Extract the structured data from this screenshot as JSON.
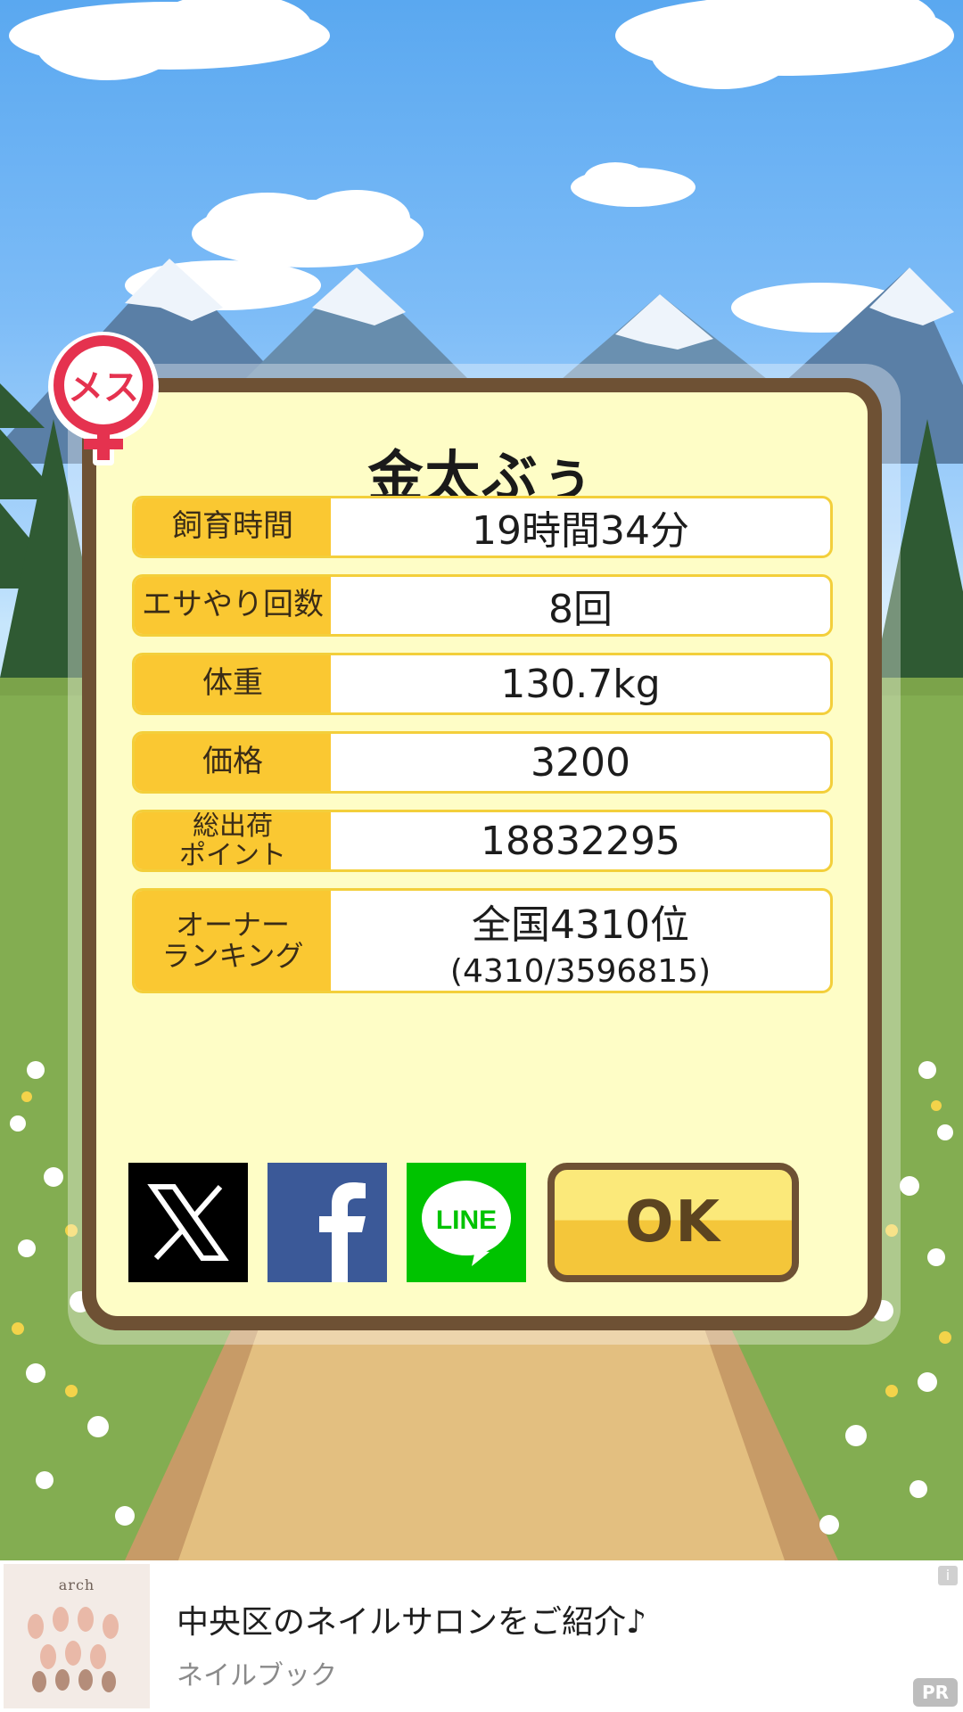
{
  "pet": {
    "name": "金太ぶぅ",
    "gender_badge": "メス"
  },
  "stats": [
    {
      "label": "飼育時間",
      "value": "19時間34分"
    },
    {
      "label": "エサやり回数",
      "value": "8回"
    },
    {
      "label": "体重",
      "value": "130.7kg"
    },
    {
      "label": "価格",
      "value": "3200"
    },
    {
      "label": "総出荷\nポイント",
      "value": "18832295"
    },
    {
      "label": "オーナー\nランキング",
      "value": "全国4310位",
      "sub": "(4310/3596815)"
    }
  ],
  "share": {
    "x_icon": "x-logo-icon",
    "facebook_icon": "facebook-logo-icon",
    "line_icon": "line-logo-icon",
    "line_text": "LINE"
  },
  "ok_label": "OK",
  "ad": {
    "title": "中央区のネイルサロンをご紹介♪",
    "subtitle": "ネイルブック",
    "thumb_brand": "arch",
    "info_label": "i",
    "pr_label": "PR"
  },
  "colors": {
    "dialog_bg": "#fefdc6",
    "dialog_border": "#6e5134",
    "label_bg": "#fac832",
    "badge_red": "#e5324f"
  }
}
